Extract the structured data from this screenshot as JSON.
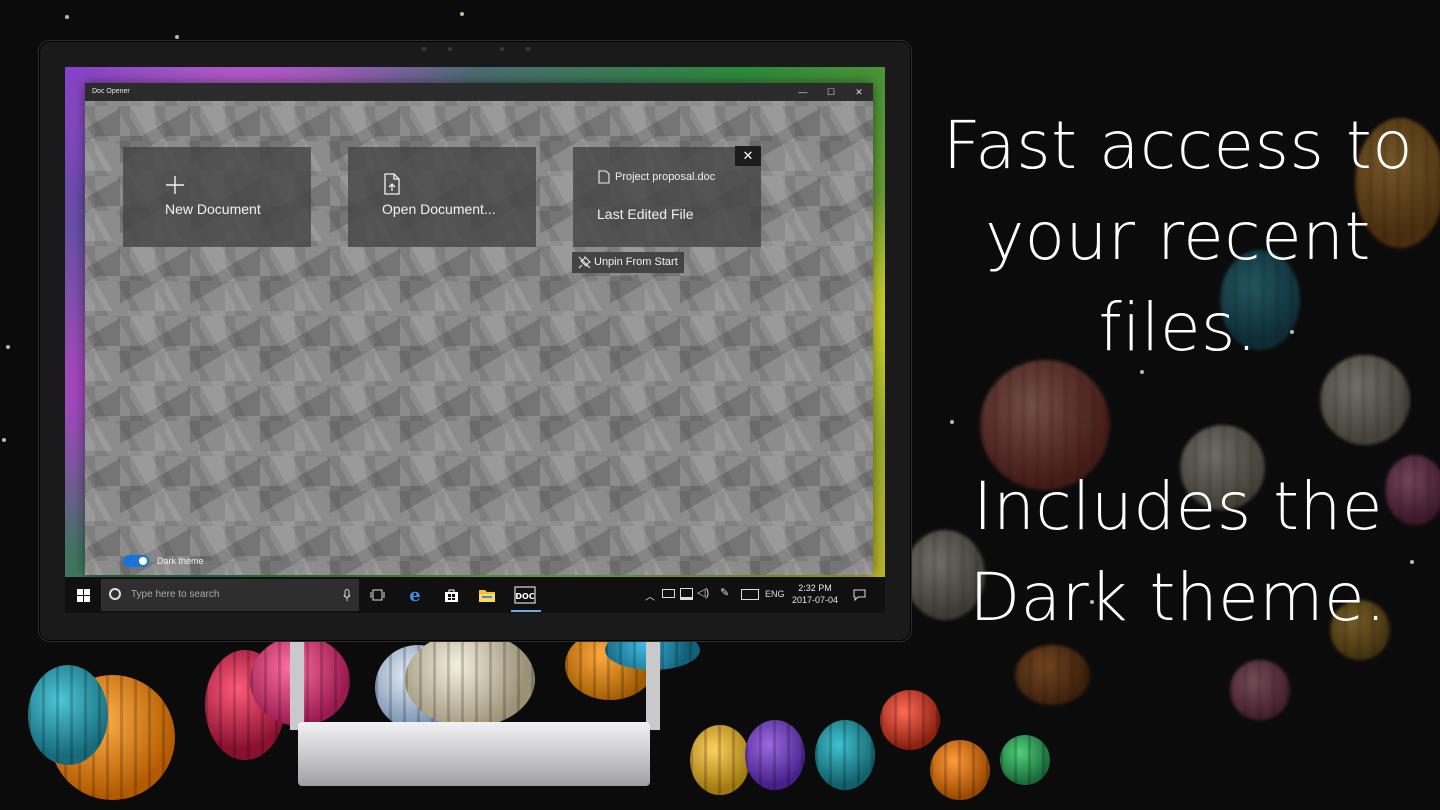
{
  "promo": {
    "line1": "Fast access to",
    "line2": "your recent",
    "line3": "files.",
    "line4": "Includes the",
    "line5": "Dark theme."
  },
  "app": {
    "title": "Doc Opener",
    "window_controls": {
      "minimize": "—",
      "maximize": "☐",
      "close": "✕"
    },
    "tiles": {
      "new_document": "New Document",
      "open_document": "Open Document...",
      "recent_file_name": "Project proposal.doc",
      "last_edited": "Last Edited File"
    },
    "unpin_close": "✕",
    "unpin_label": "Unpin From Start",
    "dark_theme_label": "Dark theme",
    "dark_theme_on": true
  },
  "taskbar": {
    "search_placeholder": "Type here to search",
    "language": "ENG",
    "time": "2:32 PM",
    "date": "2017-07-04",
    "pinned_apps": [
      "task-view",
      "edge",
      "store",
      "file-explorer",
      "doc-opener"
    ],
    "accent": "#6fa9e8"
  },
  "colors": {
    "background": "#0b0b0c",
    "toggle_accent": "#1a73d8",
    "tile_bg": "#464646"
  }
}
